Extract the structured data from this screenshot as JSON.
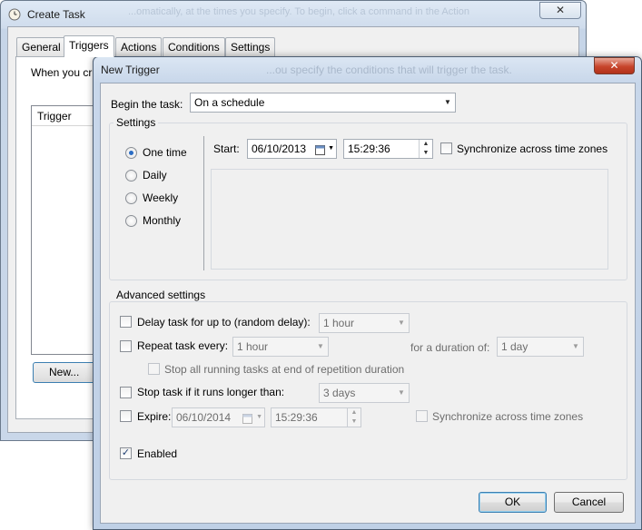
{
  "create_task": {
    "title": "Create Task",
    "close_glyph": "✕",
    "ghost_text": "...omatically, at the times you specify. To begin, click a command in the Action",
    "tabs": [
      "General",
      "Triggers",
      "Actions",
      "Conditions",
      "Settings"
    ],
    "active_tab": "Triggers",
    "description": "When you cr",
    "list_header": "Trigger",
    "new_button": "New..."
  },
  "new_trigger": {
    "title": "New Trigger",
    "ghost_text": "...ou specify the conditions that will trigger the task.",
    "close_glyph": "✕",
    "begin_label": "Begin the task:",
    "begin_value": "On a schedule",
    "settings_group": "Settings",
    "schedule_options": [
      "One time",
      "Daily",
      "Weekly",
      "Monthly"
    ],
    "selected_schedule": "One time",
    "start_label": "Start:",
    "start_date": "06/10/2013",
    "start_time": "15:29:36",
    "sync_label": "Synchronize across time zones",
    "advanced_group": "Advanced settings",
    "delay_label": "Delay task for up to (random delay):",
    "delay_value": "1 hour",
    "repeat_label": "Repeat task every:",
    "repeat_value": "1 hour",
    "duration_label": "for a duration of:",
    "duration_value": "1 day",
    "stop_all_label": "Stop all running tasks at end of repetition duration",
    "stop_longer_label": "Stop task if it runs longer than:",
    "stop_longer_value": "3 days",
    "expire_label": "Expire:",
    "expire_date": "06/10/2014",
    "expire_time": "15:29:36",
    "expire_sync_label": "Synchronize across time zones",
    "enabled_label": "Enabled",
    "enabled_checked": true,
    "ok_button": "OK",
    "cancel_button": "Cancel"
  },
  "icons": {
    "task_icon": "clock-icon",
    "dropdown": "chevron-down-icon",
    "calendar": "calendar-icon",
    "check": "check-icon"
  },
  "colors": {
    "close_red": "#c7452c",
    "radio_dot": "#2a6cc4",
    "default_button_border": "#3c7fb1"
  }
}
